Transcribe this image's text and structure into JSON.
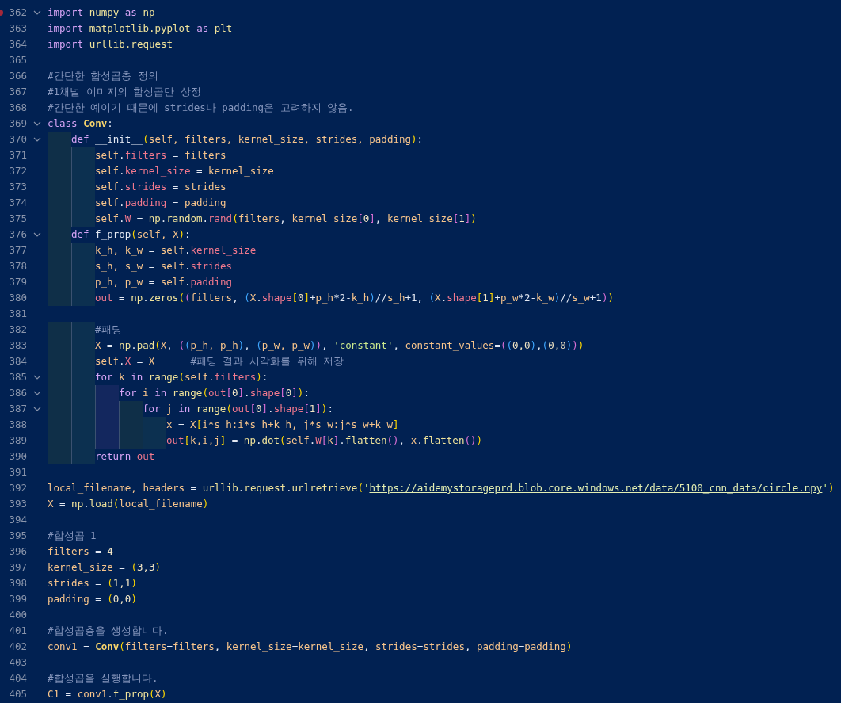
{
  "editor": {
    "lines": [
      {
        "number": "362",
        "fold": true,
        "breakpoint": true,
        "tokens": [
          {
            "text": "import ",
            "kind": "kw"
          },
          {
            "text": "numpy ",
            "kind": "mod"
          },
          {
            "text": "as ",
            "kind": "kw"
          },
          {
            "text": "np",
            "kind": "mod"
          }
        ]
      },
      {
        "number": "363",
        "fold": false,
        "breakpoint": false,
        "tokens": [
          {
            "text": "import ",
            "kind": "kw"
          },
          {
            "text": "matplotlib.pyplot ",
            "kind": "mod"
          },
          {
            "text": "as ",
            "kind": "kw"
          },
          {
            "text": "plt",
            "kind": "mod"
          }
        ]
      },
      {
        "number": "364",
        "fold": false,
        "breakpoint": false,
        "tokens": [
          {
            "text": "import ",
            "kind": "kw"
          },
          {
            "text": "urllib.request",
            "kind": "mod"
          }
        ]
      },
      {
        "number": "365",
        "fold": false,
        "breakpoint": false
      },
      {
        "number": "366",
        "fold": false,
        "breakpoint": false,
        "tokens": [
          {
            "text": "#간단한 합성곱층 정의",
            "kind": "cmt"
          }
        ]
      },
      {
        "number": "367",
        "fold": false,
        "breakpoint": false,
        "tokens": [
          {
            "text": "#1채널 이미지의 합성곱만 상정",
            "kind": "cmt"
          }
        ]
      },
      {
        "number": "368",
        "fold": false,
        "breakpoint": false,
        "tokens": [
          {
            "text": "#간단한 예이기 때문에 strides나 padding은 고려하지 않음.",
            "kind": "cmt"
          }
        ]
      },
      {
        "number": "369",
        "fold": true,
        "breakpoint": false,
        "tokens": [
          {
            "text": "class ",
            "kind": "kw"
          },
          {
            "text": "Conv",
            "kind": "cls"
          },
          {
            "text": ":",
            "kind": "txt"
          }
        ]
      },
      {
        "number": "370",
        "fold": true,
        "breakpoint": false,
        "tokens": [
          {
            "text": "    def ",
            "kind": "kw"
          },
          {
            "text": "__init__",
            "kind": "txt"
          },
          {
            "text": "(",
            "kind": "br1"
          },
          {
            "text": "self, filters, kernel_size, strides, padding",
            "kind": "var"
          },
          {
            "text": ")",
            "kind": "br1"
          },
          {
            "text": ":",
            "kind": "txt"
          }
        ]
      },
      {
        "number": "371",
        "fold": false,
        "breakpoint": false,
        "tokens": [
          {
            "text": "        self",
            "kind": "var"
          },
          {
            "text": ".",
            "kind": "txt"
          },
          {
            "text": "filters",
            "kind": "attr"
          },
          {
            "text": " = ",
            "kind": "txt"
          },
          {
            "text": "filters",
            "kind": "var"
          }
        ]
      },
      {
        "number": "372",
        "fold": false,
        "breakpoint": false,
        "tokens": [
          {
            "text": "        self",
            "kind": "var"
          },
          {
            "text": ".",
            "kind": "txt"
          },
          {
            "text": "kernel_size",
            "kind": "attr"
          },
          {
            "text": " = ",
            "kind": "txt"
          },
          {
            "text": "kernel_size",
            "kind": "var"
          }
        ]
      },
      {
        "number": "373",
        "fold": false,
        "breakpoint": false,
        "tokens": [
          {
            "text": "        self",
            "kind": "var"
          },
          {
            "text": ".",
            "kind": "txt"
          },
          {
            "text": "strides",
            "kind": "attr"
          },
          {
            "text": " = ",
            "kind": "txt"
          },
          {
            "text": "strides",
            "kind": "var"
          }
        ]
      },
      {
        "number": "374",
        "fold": false,
        "breakpoint": false,
        "tokens": [
          {
            "text": "        self",
            "kind": "var"
          },
          {
            "text": ".",
            "kind": "txt"
          },
          {
            "text": "padding",
            "kind": "attr"
          },
          {
            "text": " = ",
            "kind": "txt"
          },
          {
            "text": "padding",
            "kind": "var"
          }
        ]
      },
      {
        "number": "375",
        "fold": false,
        "breakpoint": false,
        "tokens": [
          {
            "text": "        self",
            "kind": "var"
          },
          {
            "text": ".",
            "kind": "txt"
          },
          {
            "text": "W",
            "kind": "attr"
          },
          {
            "text": " = ",
            "kind": "txt"
          },
          {
            "text": "np",
            "kind": "mod"
          },
          {
            "text": ".",
            "kind": "txt"
          },
          {
            "text": "random",
            "kind": "mod"
          },
          {
            "text": ".",
            "kind": "txt"
          },
          {
            "text": "rand",
            "kind": "attr"
          },
          {
            "text": "(",
            "kind": "br1"
          },
          {
            "text": "filters",
            "kind": "var"
          },
          {
            "text": ", ",
            "kind": "txt"
          },
          {
            "text": "kernel_size",
            "kind": "var"
          },
          {
            "text": "[",
            "kind": "br2"
          },
          {
            "text": "0",
            "kind": "num"
          },
          {
            "text": "]",
            "kind": "br2"
          },
          {
            "text": ", ",
            "kind": "txt"
          },
          {
            "text": "kernel_size",
            "kind": "var"
          },
          {
            "text": "[",
            "kind": "br2"
          },
          {
            "text": "1",
            "kind": "num"
          },
          {
            "text": "]",
            "kind": "br2"
          },
          {
            "text": ")",
            "kind": "br1"
          }
        ]
      },
      {
        "number": "376",
        "fold": true,
        "breakpoint": false,
        "tokens": [
          {
            "text": "    def ",
            "kind": "kw"
          },
          {
            "text": "f_prop",
            "kind": "txt"
          },
          {
            "text": "(",
            "kind": "br1"
          },
          {
            "text": "self, X",
            "kind": "var"
          },
          {
            "text": ")",
            "kind": "br1"
          },
          {
            "text": ":",
            "kind": "txt"
          }
        ]
      },
      {
        "number": "377",
        "fold": false,
        "breakpoint": false,
        "tokens": [
          {
            "text": "        k_h, k_w",
            "kind": "var"
          },
          {
            "text": " = ",
            "kind": "txt"
          },
          {
            "text": "self",
            "kind": "var"
          },
          {
            "text": ".",
            "kind": "txt"
          },
          {
            "text": "kernel_size",
            "kind": "attr"
          }
        ]
      },
      {
        "number": "378",
        "fold": false,
        "breakpoint": false,
        "tokens": [
          {
            "text": "        s_h, s_w",
            "kind": "var"
          },
          {
            "text": " = ",
            "kind": "txt"
          },
          {
            "text": "self",
            "kind": "var"
          },
          {
            "text": ".",
            "kind": "txt"
          },
          {
            "text": "strides",
            "kind": "attr"
          }
        ]
      },
      {
        "number": "379",
        "fold": false,
        "breakpoint": false,
        "tokens": [
          {
            "text": "        p_h, p_w",
            "kind": "var"
          },
          {
            "text": " = ",
            "kind": "txt"
          },
          {
            "text": "self",
            "kind": "var"
          },
          {
            "text": ".",
            "kind": "txt"
          },
          {
            "text": "padding",
            "kind": "attr"
          }
        ]
      },
      {
        "number": "380",
        "fold": false,
        "breakpoint": false,
        "tokens": [
          {
            "text": "        out",
            "kind": "attr"
          },
          {
            "text": " = ",
            "kind": "txt"
          },
          {
            "text": "np",
            "kind": "mod"
          },
          {
            "text": ".",
            "kind": "txt"
          },
          {
            "text": "zeros",
            "kind": "mod"
          },
          {
            "text": "(",
            "kind": "br1"
          },
          {
            "text": "(",
            "kind": "br2"
          },
          {
            "text": "filters",
            "kind": "var"
          },
          {
            "text": ", ",
            "kind": "txt"
          },
          {
            "text": "(",
            "kind": "br3"
          },
          {
            "text": "X",
            "kind": "var"
          },
          {
            "text": ".",
            "kind": "txt"
          },
          {
            "text": "shape",
            "kind": "attr"
          },
          {
            "text": "[",
            "kind": "br1"
          },
          {
            "text": "0",
            "kind": "num"
          },
          {
            "text": "]",
            "kind": "br1"
          },
          {
            "text": "+",
            "kind": "txt"
          },
          {
            "text": "p_h",
            "kind": "var"
          },
          {
            "text": "*2-",
            "kind": "txt"
          },
          {
            "text": "k_h",
            "kind": "var"
          },
          {
            "text": ")",
            "kind": "br3"
          },
          {
            "text": "//",
            "kind": "txt"
          },
          {
            "text": "s_h",
            "kind": "var"
          },
          {
            "text": "+1, ",
            "kind": "txt"
          },
          {
            "text": "(",
            "kind": "br3"
          },
          {
            "text": "X",
            "kind": "var"
          },
          {
            "text": ".",
            "kind": "txt"
          },
          {
            "text": "shape",
            "kind": "attr"
          },
          {
            "text": "[",
            "kind": "br1"
          },
          {
            "text": "1",
            "kind": "num"
          },
          {
            "text": "]",
            "kind": "br1"
          },
          {
            "text": "+",
            "kind": "txt"
          },
          {
            "text": "p_w",
            "kind": "var"
          },
          {
            "text": "*2-",
            "kind": "txt"
          },
          {
            "text": "k_w",
            "kind": "var"
          },
          {
            "text": ")",
            "kind": "br3"
          },
          {
            "text": "//",
            "kind": "txt"
          },
          {
            "text": "s_w",
            "kind": "var"
          },
          {
            "text": "+1",
            "kind": "txt"
          },
          {
            "text": ")",
            "kind": "br2"
          },
          {
            "text": ")",
            "kind": "br1"
          }
        ]
      },
      {
        "number": "381",
        "fold": false,
        "breakpoint": false
      },
      {
        "number": "382",
        "fold": false,
        "breakpoint": false,
        "tokens": [
          {
            "text": "        #패딩",
            "kind": "cmt"
          }
        ]
      },
      {
        "number": "383",
        "fold": false,
        "breakpoint": false,
        "tokens": [
          {
            "text": "        X",
            "kind": "var"
          },
          {
            "text": " = ",
            "kind": "txt"
          },
          {
            "text": "np",
            "kind": "mod"
          },
          {
            "text": ".",
            "kind": "txt"
          },
          {
            "text": "pad",
            "kind": "mod"
          },
          {
            "text": "(",
            "kind": "br1"
          },
          {
            "text": "X",
            "kind": "var"
          },
          {
            "text": ", ",
            "kind": "txt"
          },
          {
            "text": "(",
            "kind": "br2"
          },
          {
            "text": "(",
            "kind": "br3"
          },
          {
            "text": "p_h, p_h",
            "kind": "var"
          },
          {
            "text": ")",
            "kind": "br3"
          },
          {
            "text": ", ",
            "kind": "txt"
          },
          {
            "text": "(",
            "kind": "br3"
          },
          {
            "text": "p_w, p_w",
            "kind": "var"
          },
          {
            "text": ")",
            "kind": "br3"
          },
          {
            "text": ")",
            "kind": "br2"
          },
          {
            "text": ", ",
            "kind": "txt"
          },
          {
            "text": "'constant'",
            "kind": "str"
          },
          {
            "text": ", ",
            "kind": "txt"
          },
          {
            "text": "constant_values",
            "kind": "var"
          },
          {
            "text": "=",
            "kind": "txt"
          },
          {
            "text": "(",
            "kind": "br2"
          },
          {
            "text": "(",
            "kind": "br3"
          },
          {
            "text": "0,0",
            "kind": "num"
          },
          {
            "text": ")",
            "kind": "br3"
          },
          {
            "text": ",",
            "kind": "txt"
          },
          {
            "text": "(",
            "kind": "br3"
          },
          {
            "text": "0,0",
            "kind": "num"
          },
          {
            "text": ")",
            "kind": "br3"
          },
          {
            "text": ")",
            "kind": "br2"
          },
          {
            "text": ")",
            "kind": "br1"
          }
        ]
      },
      {
        "number": "384",
        "fold": false,
        "breakpoint": false,
        "tokens": [
          {
            "text": "        self",
            "kind": "var"
          },
          {
            "text": ".",
            "kind": "txt"
          },
          {
            "text": "X",
            "kind": "attr"
          },
          {
            "text": " = ",
            "kind": "txt"
          },
          {
            "text": "X      ",
            "kind": "var"
          },
          {
            "text": "#패딩 결과 시각화를 위해 저장",
            "kind": "cmt"
          }
        ]
      },
      {
        "number": "385",
        "fold": true,
        "breakpoint": false,
        "tokens": [
          {
            "text": "        for ",
            "kind": "kw"
          },
          {
            "text": "k ",
            "kind": "var"
          },
          {
            "text": "in ",
            "kind": "kw"
          },
          {
            "text": "range",
            "kind": "mod"
          },
          {
            "text": "(",
            "kind": "br1"
          },
          {
            "text": "self",
            "kind": "var"
          },
          {
            "text": ".",
            "kind": "txt"
          },
          {
            "text": "filters",
            "kind": "attr"
          },
          {
            "text": ")",
            "kind": "br1"
          },
          {
            "text": ":",
            "kind": "txt"
          }
        ]
      },
      {
        "number": "386",
        "fold": true,
        "breakpoint": false,
        "tokens": [
          {
            "text": "            for ",
            "kind": "kw"
          },
          {
            "text": "i ",
            "kind": "var"
          },
          {
            "text": "in ",
            "kind": "kw"
          },
          {
            "text": "range",
            "kind": "mod"
          },
          {
            "text": "(",
            "kind": "br1"
          },
          {
            "text": "out",
            "kind": "attr"
          },
          {
            "text": "[",
            "kind": "br2"
          },
          {
            "text": "0",
            "kind": "num"
          },
          {
            "text": "]",
            "kind": "br2"
          },
          {
            "text": ".",
            "kind": "txt"
          },
          {
            "text": "shape",
            "kind": "attr"
          },
          {
            "text": "[",
            "kind": "br2"
          },
          {
            "text": "0",
            "kind": "num"
          },
          {
            "text": "]",
            "kind": "br2"
          },
          {
            "text": ")",
            "kind": "br1"
          },
          {
            "text": ":",
            "kind": "txt"
          }
        ]
      },
      {
        "number": "387",
        "fold": true,
        "breakpoint": false,
        "tokens": [
          {
            "text": "                for ",
            "kind": "kw"
          },
          {
            "text": "j ",
            "kind": "var"
          },
          {
            "text": "in ",
            "kind": "kw"
          },
          {
            "text": "range",
            "kind": "mod"
          },
          {
            "text": "(",
            "kind": "br1"
          },
          {
            "text": "out",
            "kind": "attr"
          },
          {
            "text": "[",
            "kind": "br2"
          },
          {
            "text": "0",
            "kind": "num"
          },
          {
            "text": "]",
            "kind": "br2"
          },
          {
            "text": ".",
            "kind": "txt"
          },
          {
            "text": "shape",
            "kind": "attr"
          },
          {
            "text": "[",
            "kind": "br2"
          },
          {
            "text": "1",
            "kind": "num"
          },
          {
            "text": "]",
            "kind": "br2"
          },
          {
            "text": ")",
            "kind": "br1"
          },
          {
            "text": ":",
            "kind": "txt"
          }
        ]
      },
      {
        "number": "388",
        "fold": false,
        "breakpoint": false,
        "tokens": [
          {
            "text": "                    x",
            "kind": "var"
          },
          {
            "text": " = ",
            "kind": "txt"
          },
          {
            "text": "X",
            "kind": "var"
          },
          {
            "text": "[",
            "kind": "br1"
          },
          {
            "text": "i*s_h:i*s_h+k_h, j*s_w:j*s_w+k_w",
            "kind": "var"
          },
          {
            "text": "]",
            "kind": "br1"
          }
        ]
      },
      {
        "number": "389",
        "fold": false,
        "breakpoint": false,
        "tokens": [
          {
            "text": "                    out",
            "kind": "attr"
          },
          {
            "text": "[",
            "kind": "br1"
          },
          {
            "text": "k,i,j",
            "kind": "var"
          },
          {
            "text": "]",
            "kind": "br1"
          },
          {
            "text": " = ",
            "kind": "txt"
          },
          {
            "text": "np",
            "kind": "mod"
          },
          {
            "text": ".",
            "kind": "txt"
          },
          {
            "text": "dot",
            "kind": "mod"
          },
          {
            "text": "(",
            "kind": "br1"
          },
          {
            "text": "self",
            "kind": "var"
          },
          {
            "text": ".",
            "kind": "txt"
          },
          {
            "text": "W",
            "kind": "attr"
          },
          {
            "text": "[",
            "kind": "br2"
          },
          {
            "text": "k",
            "kind": "var"
          },
          {
            "text": "]",
            "kind": "br2"
          },
          {
            "text": ".",
            "kind": "txt"
          },
          {
            "text": "flatten",
            "kind": "mod"
          },
          {
            "text": "()",
            "kind": "br2"
          },
          {
            "text": ", ",
            "kind": "txt"
          },
          {
            "text": "x",
            "kind": "var"
          },
          {
            "text": ".",
            "kind": "txt"
          },
          {
            "text": "flatten",
            "kind": "mod"
          },
          {
            "text": "()",
            "kind": "br2"
          },
          {
            "text": ")",
            "kind": "br1"
          }
        ]
      },
      {
        "number": "390",
        "fold": false,
        "breakpoint": false,
        "tokens": [
          {
            "text": "        return ",
            "kind": "kw"
          },
          {
            "text": "out",
            "kind": "attr"
          }
        ]
      },
      {
        "number": "391",
        "fold": false,
        "breakpoint": false
      },
      {
        "number": "392",
        "fold": false,
        "breakpoint": false,
        "tokens": [
          {
            "text": "local_filename, headers",
            "kind": "var"
          },
          {
            "text": " = ",
            "kind": "txt"
          },
          {
            "text": "urllib",
            "kind": "mod"
          },
          {
            "text": ".",
            "kind": "txt"
          },
          {
            "text": "request",
            "kind": "mod"
          },
          {
            "text": ".",
            "kind": "txt"
          },
          {
            "text": "urlretrieve",
            "kind": "mod"
          },
          {
            "text": "(",
            "kind": "br1"
          },
          {
            "text": "'",
            "kind": "str"
          },
          {
            "text": "https://aidemystorageprd.blob.core.windows.net/data/5100_cnn_data/circle.npy",
            "kind": "url"
          },
          {
            "text": "'",
            "kind": "str"
          },
          {
            "text": ")",
            "kind": "br1"
          }
        ]
      },
      {
        "number": "393",
        "fold": false,
        "breakpoint": false,
        "tokens": [
          {
            "text": "X",
            "kind": "var"
          },
          {
            "text": " = ",
            "kind": "txt"
          },
          {
            "text": "np",
            "kind": "mod"
          },
          {
            "text": ".",
            "kind": "txt"
          },
          {
            "text": "load",
            "kind": "mod"
          },
          {
            "text": "(",
            "kind": "br1"
          },
          {
            "text": "local_filename",
            "kind": "var"
          },
          {
            "text": ")",
            "kind": "br1"
          }
        ]
      },
      {
        "number": "394",
        "fold": false,
        "breakpoint": false
      },
      {
        "number": "395",
        "fold": false,
        "breakpoint": false,
        "tokens": [
          {
            "text": "#합성곱 1",
            "kind": "cmt"
          }
        ]
      },
      {
        "number": "396",
        "fold": false,
        "breakpoint": false,
        "tokens": [
          {
            "text": "filters",
            "kind": "var"
          },
          {
            "text": " = ",
            "kind": "txt"
          },
          {
            "text": "4",
            "kind": "num"
          }
        ]
      },
      {
        "number": "397",
        "fold": false,
        "breakpoint": false,
        "tokens": [
          {
            "text": "kernel_size",
            "kind": "var"
          },
          {
            "text": " = ",
            "kind": "txt"
          },
          {
            "text": "(",
            "kind": "br1"
          },
          {
            "text": "3,3",
            "kind": "num"
          },
          {
            "text": ")",
            "kind": "br1"
          }
        ]
      },
      {
        "number": "398",
        "fold": false,
        "breakpoint": false,
        "tokens": [
          {
            "text": "strides",
            "kind": "var"
          },
          {
            "text": " = ",
            "kind": "txt"
          },
          {
            "text": "(",
            "kind": "br1"
          },
          {
            "text": "1,1",
            "kind": "num"
          },
          {
            "text": ")",
            "kind": "br1"
          }
        ]
      },
      {
        "number": "399",
        "fold": false,
        "breakpoint": false,
        "tokens": [
          {
            "text": "padding",
            "kind": "var"
          },
          {
            "text": " = ",
            "kind": "txt"
          },
          {
            "text": "(",
            "kind": "br1"
          },
          {
            "text": "0,0",
            "kind": "num"
          },
          {
            "text": ")",
            "kind": "br1"
          }
        ]
      },
      {
        "number": "400",
        "fold": false,
        "breakpoint": false
      },
      {
        "number": "401",
        "fold": false,
        "breakpoint": false,
        "tokens": [
          {
            "text": "#합성곱층을 생성합니다.",
            "kind": "cmt"
          }
        ]
      },
      {
        "number": "402",
        "fold": false,
        "breakpoint": false,
        "tokens": [
          {
            "text": "conv1",
            "kind": "var"
          },
          {
            "text": " = ",
            "kind": "txt"
          },
          {
            "text": "Conv",
            "kind": "cls"
          },
          {
            "text": "(",
            "kind": "br1"
          },
          {
            "text": "filters",
            "kind": "var"
          },
          {
            "text": "=",
            "kind": "txt"
          },
          {
            "text": "filters",
            "kind": "var"
          },
          {
            "text": ", ",
            "kind": "txt"
          },
          {
            "text": "kernel_size",
            "kind": "var"
          },
          {
            "text": "=",
            "kind": "txt"
          },
          {
            "text": "kernel_size",
            "kind": "var"
          },
          {
            "text": ", ",
            "kind": "txt"
          },
          {
            "text": "strides",
            "kind": "var"
          },
          {
            "text": "=",
            "kind": "txt"
          },
          {
            "text": "strides",
            "kind": "var"
          },
          {
            "text": ", ",
            "kind": "txt"
          },
          {
            "text": "padding",
            "kind": "var"
          },
          {
            "text": "=",
            "kind": "txt"
          },
          {
            "text": "padding",
            "kind": "var"
          },
          {
            "text": ")",
            "kind": "br1"
          }
        ]
      },
      {
        "number": "403",
        "fold": false,
        "breakpoint": false
      },
      {
        "number": "404",
        "fold": false,
        "breakpoint": false,
        "tokens": [
          {
            "text": "#합성곱을 실행합니다.",
            "kind": "cmt"
          }
        ]
      },
      {
        "number": "405",
        "fold": false,
        "breakpoint": false,
        "tokens": [
          {
            "text": "C1",
            "kind": "var"
          },
          {
            "text": " = ",
            "kind": "txt"
          },
          {
            "text": "conv1",
            "kind": "var"
          },
          {
            "text": ".",
            "kind": "txt"
          },
          {
            "text": "f_prop",
            "kind": "mod"
          },
          {
            "text": "(",
            "kind": "br1"
          },
          {
            "text": "X",
            "kind": "var"
          },
          {
            "text": ")",
            "kind": "br1"
          }
        ]
      }
    ]
  }
}
